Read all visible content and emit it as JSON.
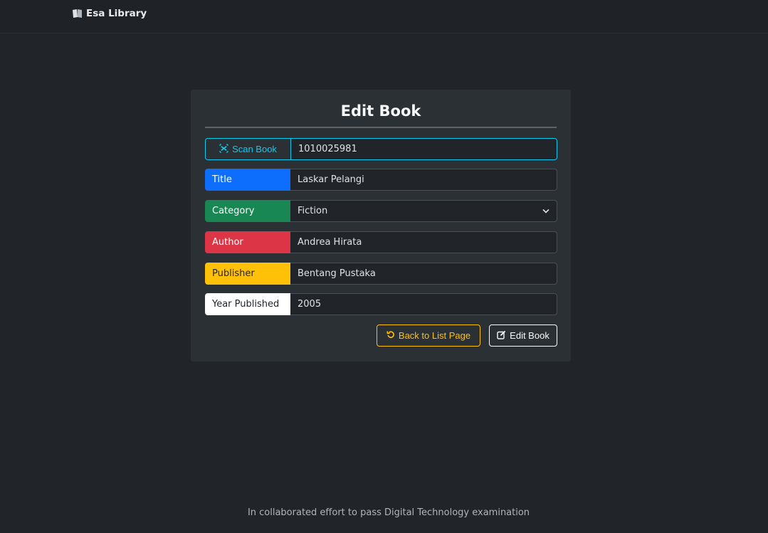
{
  "navbar": {
    "brand": "Esa Library",
    "brand_icon": "book-icon"
  },
  "form": {
    "title": "Edit Book",
    "scan": {
      "label": "Scan Book",
      "icon": "barcode-scan-icon",
      "value": "1010025981",
      "color": "#0dcaf0"
    },
    "fields": {
      "title": {
        "label": "Title",
        "value": "Laskar Pelangi",
        "color": "#0d6efd"
      },
      "category": {
        "label": "Category",
        "value": "Fiction",
        "color": "#198754"
      },
      "author": {
        "label": "Author",
        "value": "Andrea Hirata",
        "color": "#dc3545"
      },
      "publisher": {
        "label": "Publisher",
        "value": "Bentang Pustaka",
        "color": "#ffc107"
      },
      "year": {
        "label": "Year Published",
        "value": "2005",
        "color": "#ffffff"
      }
    },
    "buttons": {
      "back": {
        "label": "Back to List Page",
        "icon": "undo-icon",
        "color": "#ffc107"
      },
      "edit": {
        "label": "Edit Book",
        "icon": "edit-icon",
        "color": "#f8f9fa"
      }
    }
  },
  "footer": {
    "text": "In collaborated effort to pass Digital Technology examination"
  }
}
